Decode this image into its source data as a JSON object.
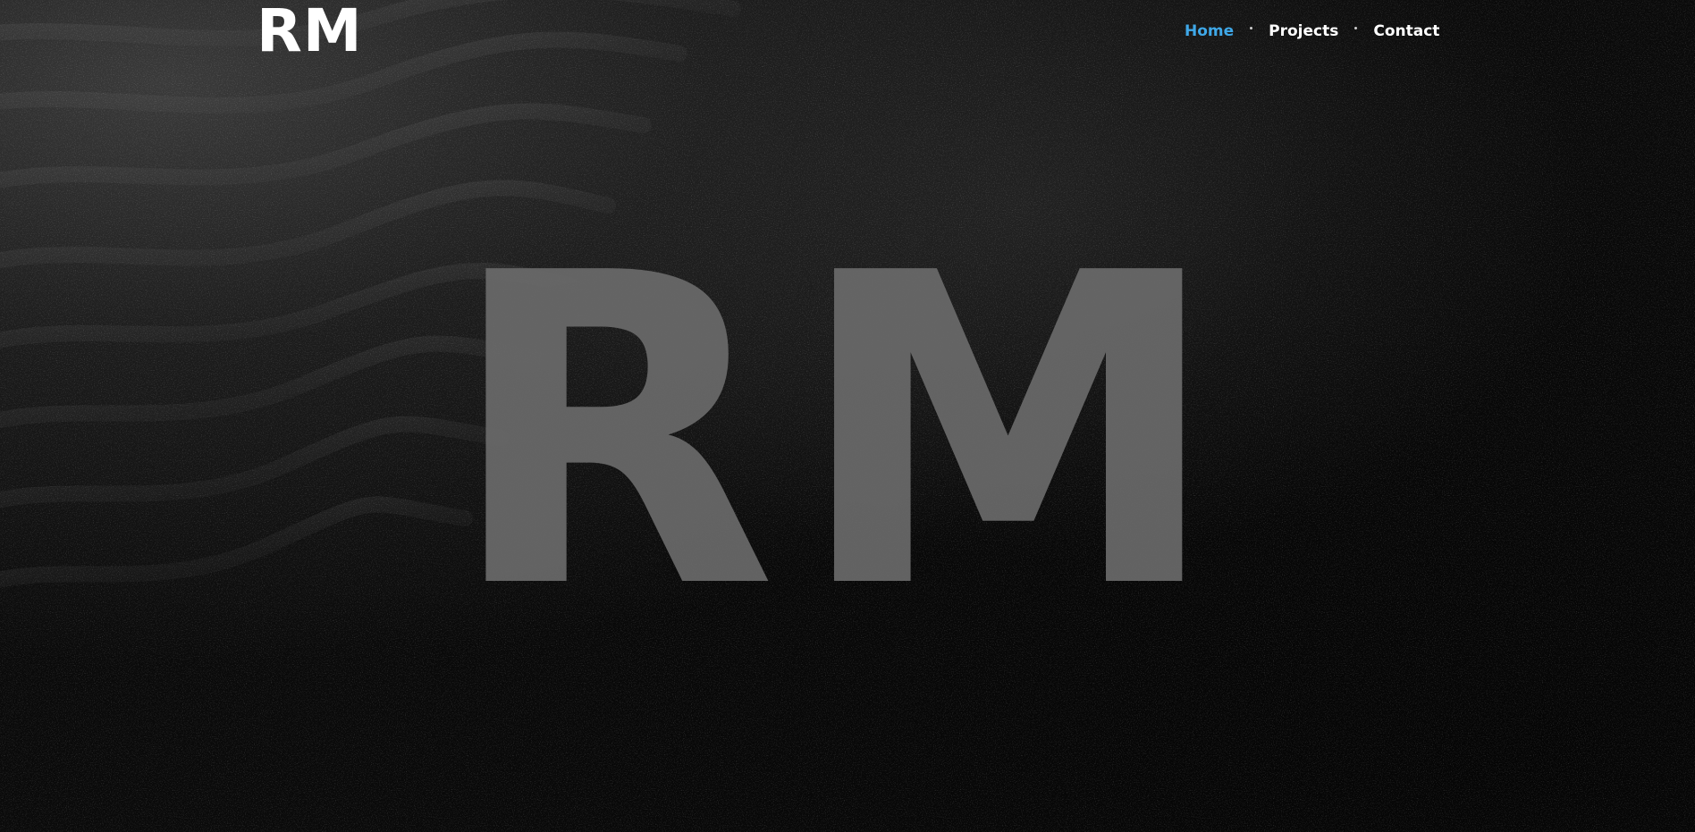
{
  "header": {
    "logo": "RM"
  },
  "nav": {
    "items": [
      {
        "label": "Home",
        "active": true
      },
      {
        "label": "Projects",
        "active": false
      },
      {
        "label": "Contact",
        "active": false
      }
    ]
  },
  "hero": {
    "monogram": "RM"
  },
  "colors": {
    "accent": "#3fa8e8",
    "text": "#ffffff",
    "hero_letters": "#6a6a6a"
  }
}
